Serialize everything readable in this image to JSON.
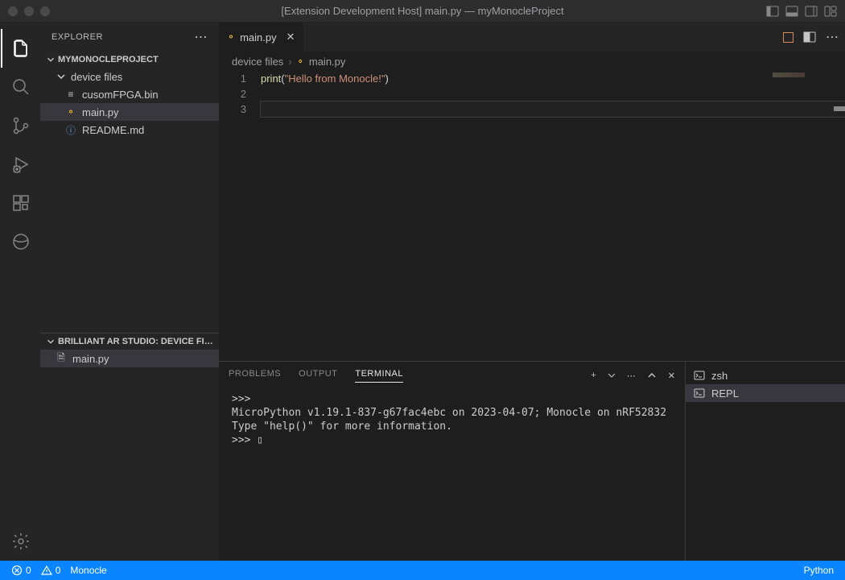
{
  "title": "[Extension Development Host] main.py — myMonocleProject",
  "sidebar": {
    "header": "EXPLORER",
    "project": "MYMONOCLEPROJECT",
    "folder": "device files",
    "files": [
      "cusomFPGA.bin",
      "main.py",
      "README.md"
    ],
    "section2": "BRILLIANT AR STUDIO: DEVICE FI…",
    "section2_files": [
      "main.py"
    ]
  },
  "tab": {
    "name": "main.py"
  },
  "breadcrumbs": [
    "device files",
    "main.py"
  ],
  "editor": {
    "line_numbers": [
      "1",
      "2",
      "3"
    ],
    "code_fn": "print",
    "code_paren_open": "(",
    "code_str": "\"Hello from Monocle!\"",
    "code_paren_close": ")"
  },
  "panel": {
    "tabs": [
      "PROBLEMS",
      "OUTPUT",
      "TERMINAL"
    ],
    "terminal": ">>> \nMicroPython v1.19.1-837-g67fac4ebc on 2023-04-07; Monocle on nRF52832\nType \"help()\" for more information.\n>>> ▯",
    "side": [
      "zsh",
      "REPL"
    ]
  },
  "status": {
    "errors": "0",
    "warnings": "0",
    "device": "Monocle",
    "lang": "Python"
  }
}
